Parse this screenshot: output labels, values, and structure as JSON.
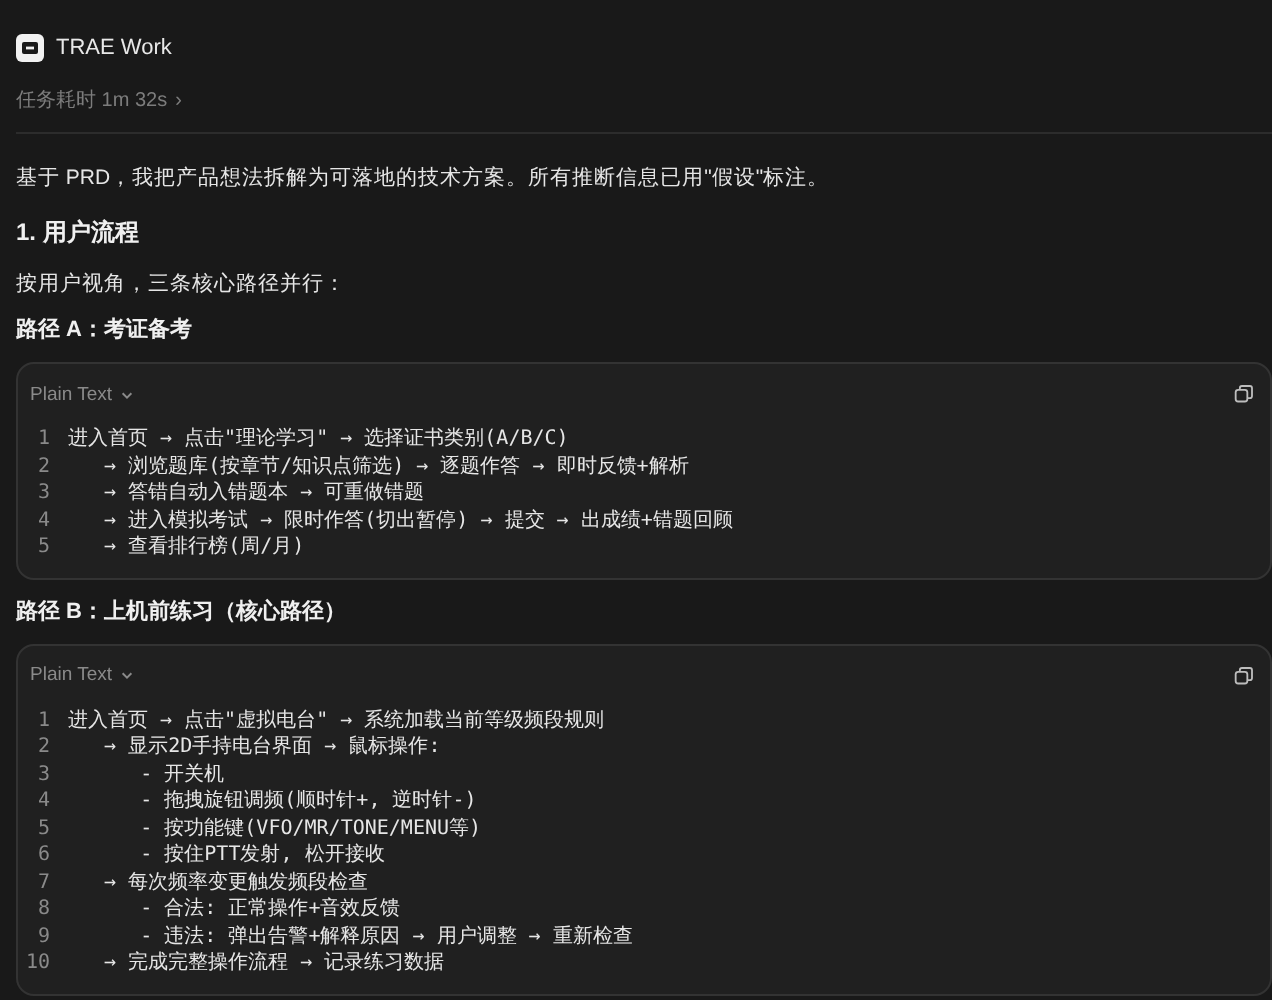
{
  "app": {
    "title": "TRAE Work"
  },
  "task": {
    "duration": "任务耗时 1m 32s",
    "chevron": "›"
  },
  "intro": "基于 PRD，我把产品想法拆解为可落地的技术方案。所有推断信息已用\"假设\"标注。",
  "section": {
    "heading": "1. 用户流程",
    "lead": "按用户视角，三条核心路径并行："
  },
  "paths": [
    {
      "heading": "路径 A：考证备考",
      "block": {
        "language": "Plain Text",
        "lines": [
          {
            "number": "1",
            "text": "进入首页 → 点击\"理论学习\" → 选择证书类别(A/B/C)"
          },
          {
            "number": "2",
            "text": "   → 浏览题库(按章节/知识点筛选) → 逐题作答 → 即时反馈+解析"
          },
          {
            "number": "3",
            "text": "   → 答错自动入错题本 → 可重做错题"
          },
          {
            "number": "4",
            "text": "   → 进入模拟考试 → 限时作答(切出暂停) → 提交 → 出成绩+错题回顾"
          },
          {
            "number": "5",
            "text": "   → 查看排行榜(周/月)"
          }
        ]
      }
    },
    {
      "heading": "路径 B：上机前练习（核心路径）",
      "block": {
        "language": "Plain Text",
        "lines": [
          {
            "number": "1",
            "text": "进入首页 → 点击\"虚拟电台\" → 系统加载当前等级频段规则"
          },
          {
            "number": "2",
            "text": "   → 显示2D手持电台界面 → 鼠标操作:"
          },
          {
            "number": "3",
            "text": "      - 开关机"
          },
          {
            "number": "4",
            "text": "      - 拖拽旋钮调频(顺时针+, 逆时针-)"
          },
          {
            "number": "5",
            "text": "      - 按功能键(VFO/MR/TONE/MENU等)"
          },
          {
            "number": "6",
            "text": "      - 按住PTT发射, 松开接收"
          },
          {
            "number": "7",
            "text": "   → 每次频率变更触发频段检查"
          },
          {
            "number": "8",
            "text": "      - 合法: 正常操作+音效反馈"
          },
          {
            "number": "9",
            "text": "      - 违法: 弹出告警+解释原因 → 用户调整 → 重新检查"
          },
          {
            "number": "10",
            "text": "   → 完成完整操作流程 → 记录练习数据"
          }
        ]
      }
    }
  ]
}
